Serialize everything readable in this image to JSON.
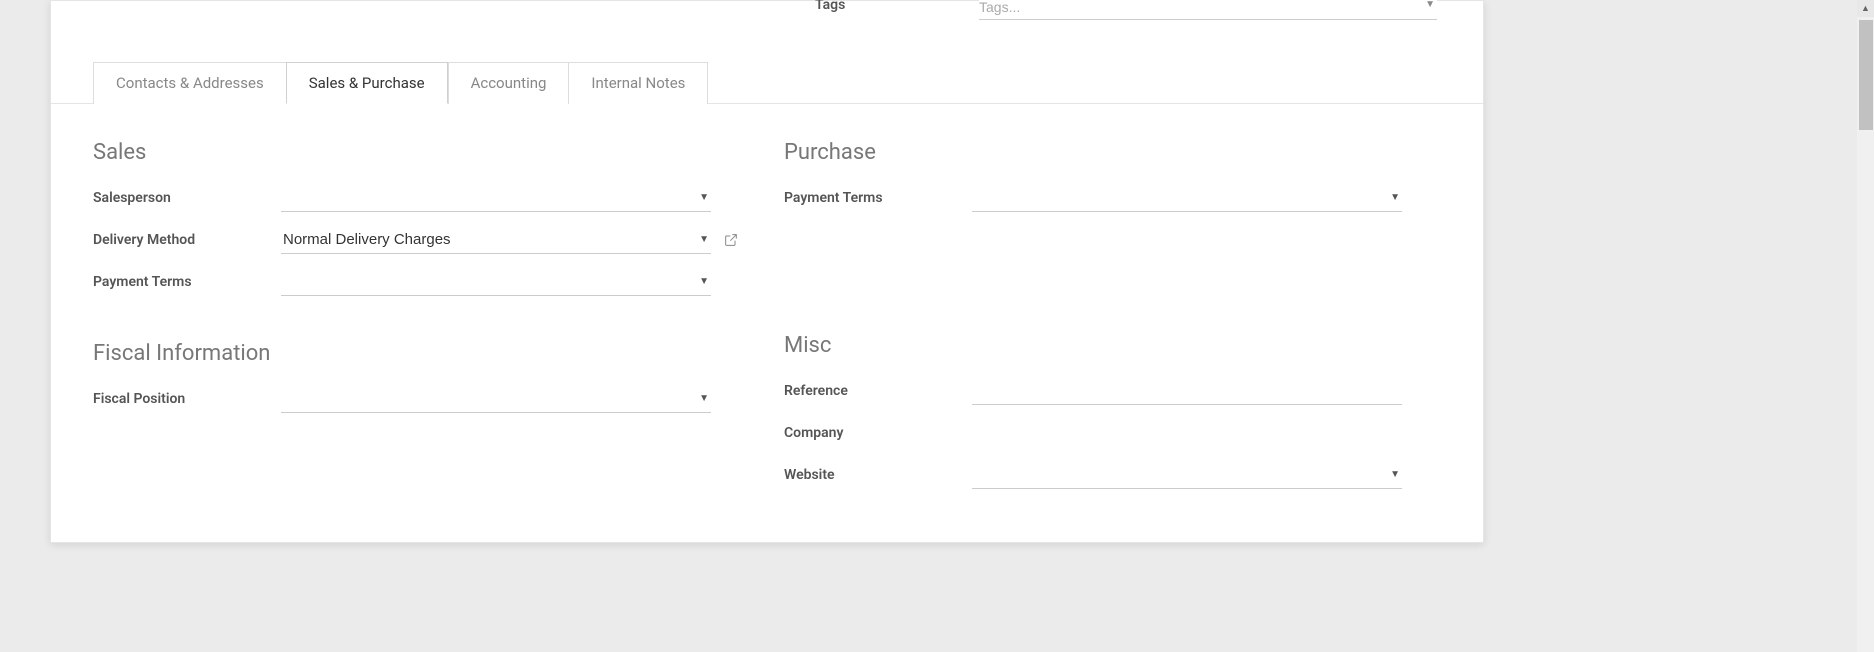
{
  "header": {
    "tags_label": "Tags",
    "tags_placeholder": "Tags..."
  },
  "tabs": [
    {
      "label": "Contacts & Addresses",
      "active": false
    },
    {
      "label": "Sales & Purchase",
      "active": true
    },
    {
      "label": "Accounting",
      "active": false
    },
    {
      "label": "Internal Notes",
      "active": false
    }
  ],
  "sales": {
    "title": "Sales",
    "salesperson_label": "Salesperson",
    "salesperson_value": "",
    "delivery_method_label": "Delivery Method",
    "delivery_method_value": "Normal Delivery Charges",
    "payment_terms_label": "Payment Terms",
    "payment_terms_value": ""
  },
  "fiscal": {
    "title": "Fiscal Information",
    "fiscal_position_label": "Fiscal Position",
    "fiscal_position_value": ""
  },
  "purchase": {
    "title": "Purchase",
    "payment_terms_label": "Payment Terms",
    "payment_terms_value": ""
  },
  "misc": {
    "title": "Misc",
    "reference_label": "Reference",
    "reference_value": "",
    "company_label": "Company",
    "company_value": "",
    "website_label": "Website",
    "website_value": ""
  }
}
